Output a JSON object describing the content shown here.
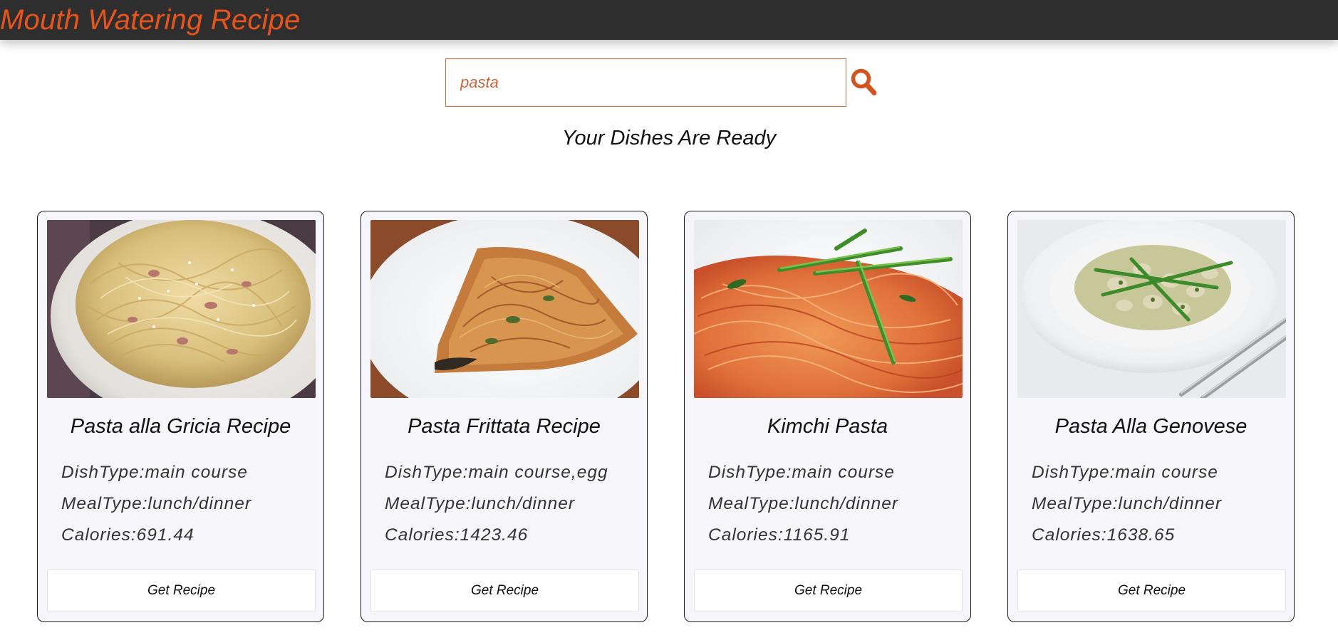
{
  "app": {
    "brand": "Mouth Watering Recipe",
    "accent_color": "#e8541c",
    "navbar_color": "#2e2e2e"
  },
  "search": {
    "value": "pasta",
    "icon": "search-icon"
  },
  "results": {
    "heading": "Your Dishes Are Ready"
  },
  "recipes": [
    {
      "title": "Pasta alla Gricia Recipe",
      "dish_type": "DishType:main course",
      "meal_type": "MealType:lunch/dinner",
      "calories": "Calories:691.44",
      "button": "Get Recipe",
      "image": "pasta-alla-gricia-photo"
    },
    {
      "title": "Pasta Frittata Recipe",
      "dish_type": "DishType:main course,egg",
      "meal_type": "MealType:lunch/dinner",
      "calories": "Calories:1423.46",
      "button": "Get Recipe",
      "image": "pasta-frittata-photo"
    },
    {
      "title": "Kimchi Pasta",
      "dish_type": "DishType:main course",
      "meal_type": "MealType:lunch/dinner",
      "calories": "Calories:1165.91",
      "button": "Get Recipe",
      "image": "kimchi-pasta-photo"
    },
    {
      "title": "Pasta Alla Genovese",
      "dish_type": "DishType:main course",
      "meal_type": "MealType:lunch/dinner",
      "calories": "Calories:1638.65",
      "button": "Get Recipe",
      "image": "pasta-alla-genovese-photo"
    }
  ]
}
